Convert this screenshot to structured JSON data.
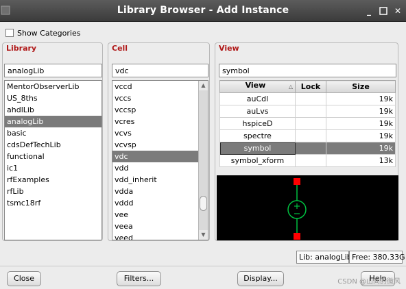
{
  "window": {
    "title": "Library Browser - Add Instance"
  },
  "options": {
    "show_categories_label": "Show Categories",
    "show_categories_checked": false
  },
  "library": {
    "label": "Library",
    "filter_value": "analogLib",
    "items": [
      "MentorObserverLib",
      "US_8ths",
      "ahdlLib",
      "analogLib",
      "basic",
      "cdsDefTechLib",
      "functional",
      "ic1",
      "rfExamples",
      "rfLib",
      "tsmc18rf"
    ],
    "selected": "analogLib"
  },
  "cell": {
    "label": "Cell",
    "filter_value": "vdc",
    "items": [
      "vccd",
      "vccs",
      "vccsp",
      "vcres",
      "vcvs",
      "vcvsp",
      "vdc",
      "vdd",
      "vdd_inherit",
      "vdda",
      "vddd",
      "vee",
      "veea",
      "veed"
    ],
    "selected": "vdc"
  },
  "view": {
    "label": "View",
    "filter_value": "symbol",
    "columns": [
      "View",
      "Lock",
      "Size"
    ],
    "rows": [
      {
        "view": "auCdl",
        "lock": "",
        "size": "19k"
      },
      {
        "view": "auLvs",
        "lock": "",
        "size": "19k"
      },
      {
        "view": "hspiceD",
        "lock": "",
        "size": "19k"
      },
      {
        "view": "spectre",
        "lock": "",
        "size": "19k"
      },
      {
        "view": "symbol",
        "lock": "",
        "size": "19k"
      },
      {
        "view": "symbol_xform",
        "lock": "",
        "size": "13k"
      }
    ],
    "selected": "symbol",
    "preview_symbol": "dc-voltage-source"
  },
  "status": {
    "lib": "Lib: analogLib",
    "free": "Free: 380.33G"
  },
  "buttons": {
    "close": "Close",
    "filters": "Filters...",
    "display": "Display...",
    "help": "Help"
  },
  "watermark": "CSDN @山间的微风",
  "colors": {
    "group_label": "#b01818",
    "selection": "#7b7b7b",
    "preview_bg": "#000000",
    "pin": "#ff0000",
    "symbol_stroke": "#00c040"
  }
}
